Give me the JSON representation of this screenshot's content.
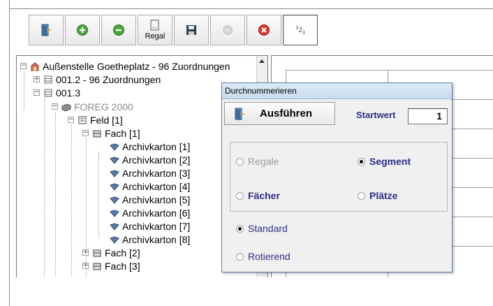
{
  "toolbar": {
    "buttons": [
      {
        "name": "exit",
        "icon": "exit-door-icon",
        "label": ""
      },
      {
        "name": "add",
        "icon": "plus-circle-icon",
        "label": ""
      },
      {
        "name": "remove",
        "icon": "minus-circle-icon",
        "label": ""
      },
      {
        "name": "regal",
        "icon": "document-icon",
        "label": "Regal"
      },
      {
        "name": "save",
        "icon": "floppy-disk-icon",
        "label": ""
      },
      {
        "name": "settings",
        "icon": "gear-icon",
        "label": ""
      },
      {
        "name": "cancel",
        "icon": "close-circle-icon",
        "label": ""
      },
      {
        "name": "numbering",
        "icon": "numbering-icon",
        "label": ""
      }
    ],
    "numbering_glyph": {
      "a": "1",
      "b": "2",
      "c": "3"
    }
  },
  "tree": {
    "items": [
      {
        "label": "Außenstelle Goetheplatz  -  96 Zuordnungen",
        "icon": "building-icon",
        "expander": "−",
        "level": 0
      },
      {
        "label": "001.2  -  96 Zuordnungen",
        "icon": "shelf-icon",
        "expander": "+",
        "level": 1
      },
      {
        "label": "001.3",
        "icon": "shelf-icon",
        "expander": "−",
        "level": 1
      },
      {
        "label": "FOREG 2000",
        "icon": "rack-icon",
        "expander": "−",
        "level": 2,
        "greyed": true
      },
      {
        "label": "Feld [1]",
        "icon": "field-icon",
        "expander": "−",
        "level": 3
      },
      {
        "label": "Fach [1]",
        "icon": "compartment-icon",
        "expander": "−",
        "level": 4
      },
      {
        "label": "Archivkarton [1]",
        "icon": "box-icon",
        "level": 5
      },
      {
        "label": "Archivkarton [2]",
        "icon": "box-icon",
        "level": 5
      },
      {
        "label": "Archivkarton [3]",
        "icon": "box-icon",
        "level": 5
      },
      {
        "label": "Archivkarton [4]",
        "icon": "box-icon",
        "level": 5
      },
      {
        "label": "Archivkarton [5]",
        "icon": "box-icon",
        "level": 5
      },
      {
        "label": "Archivkarton [6]",
        "icon": "box-icon",
        "level": 5
      },
      {
        "label": "Archivkarton [7]",
        "icon": "box-icon",
        "level": 5
      },
      {
        "label": "Archivkarton [8]",
        "icon": "box-icon",
        "level": 5
      },
      {
        "label": "Fach [2]",
        "icon": "compartment-icon",
        "expander": "+",
        "level": 4
      },
      {
        "label": "Fach [3]",
        "icon": "compartment-icon",
        "expander": "+",
        "level": 4
      }
    ]
  },
  "dialog": {
    "title": "Durchnummerieren",
    "run_button": {
      "label": "Ausführen",
      "icon": "exit-door-icon"
    },
    "startwert": {
      "label": "Startwert",
      "value": "1"
    },
    "scope_options": [
      {
        "label": "Regale",
        "selected": false,
        "enabled": false
      },
      {
        "label": "Segment",
        "selected": true,
        "enabled": true
      },
      {
        "label": "Fächer",
        "selected": false,
        "enabled": true
      },
      {
        "label": "Plätze",
        "selected": false,
        "enabled": true
      }
    ],
    "mode_options": [
      {
        "label": "Standard",
        "selected": true
      },
      {
        "label": "Rotierend",
        "selected": false
      }
    ]
  },
  "colors": {
    "dialog_text": "#2c2c8a",
    "disabled_text": "#9a9a9a",
    "dialog_title_bg": "#c8dbef",
    "dialog_border": "#5e7fa9"
  }
}
